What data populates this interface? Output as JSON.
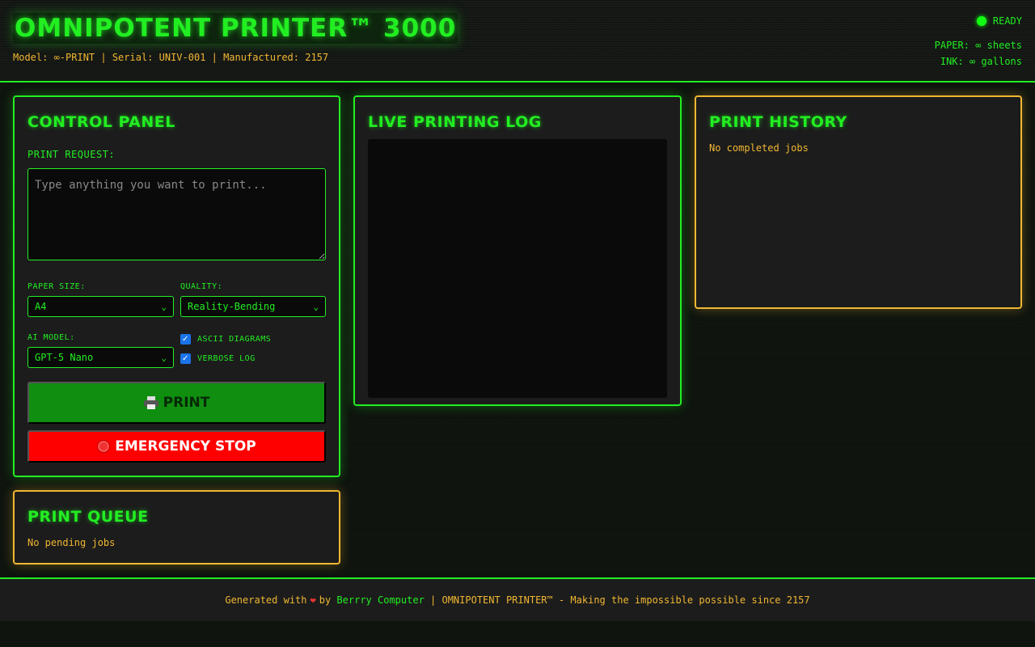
{
  "header": {
    "title": "OMNIPOTENT PRINTER™ 3000",
    "subtitle": "Model: ∞-PRINT | Serial: UNIV-001 | Manufactured: 2157",
    "status": "READY",
    "paper": "PAPER: ∞ sheets",
    "ink": "INK: ∞ gallons",
    "status_color": "#11ff11"
  },
  "control_panel": {
    "title": "CONTROL PANEL",
    "request_label": "PRINT REQUEST:",
    "request_placeholder": "Type anything you want to print...",
    "request_value": "",
    "paper_size_label": "PAPER SIZE:",
    "paper_size_value": "A4",
    "quality_label": "QUALITY:",
    "quality_value": "Reality-Bending",
    "ai_model_label": "AI MODEL:",
    "ai_model_value": "GPT-5 Nano",
    "ascii_label": "ASCII DIAGRAMS",
    "ascii_checked": true,
    "verbose_label": "VERBOSE LOG",
    "verbose_checked": true,
    "print_button": "PRINT",
    "print_icon": "printer-icon",
    "stop_button": "EMERGENCY STOP",
    "stop_icon": "stop-sign-icon"
  },
  "queue": {
    "title": "PRINT QUEUE",
    "empty": "No pending jobs"
  },
  "log": {
    "title": "LIVE PRINTING LOG"
  },
  "history": {
    "title": "PRINT HISTORY",
    "empty": "No completed jobs"
  },
  "footer": {
    "prefix": "Generated with",
    "heart_icon": "heart-icon",
    "by": "by",
    "link": "Berrry Computer",
    "suffix": "| OMNIPOTENT PRINTER™ - Making the impossible possible since 2157"
  },
  "colors": {
    "accent": "#22ee22",
    "amber": "#f0b732",
    "danger": "#ff0000",
    "print_button": "#108e10"
  }
}
